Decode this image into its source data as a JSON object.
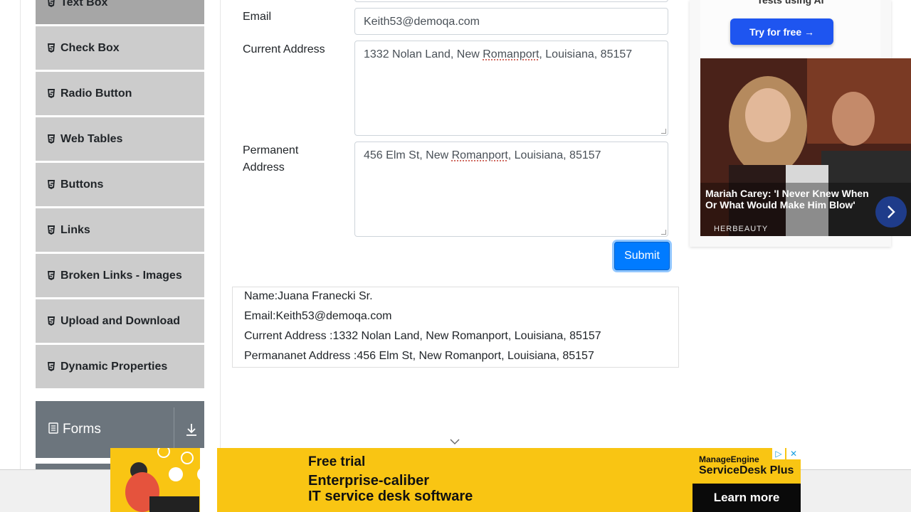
{
  "sidebar": {
    "items": [
      {
        "label": "Text Box"
      },
      {
        "label": "Check Box"
      },
      {
        "label": "Radio Button"
      },
      {
        "label": "Web Tables"
      },
      {
        "label": "Buttons"
      },
      {
        "label": "Links"
      },
      {
        "label": "Broken Links - Images"
      },
      {
        "label": "Upload and Download"
      },
      {
        "label": "Dynamic Properties"
      }
    ],
    "next_group": {
      "label": "Forms"
    }
  },
  "form": {
    "email": {
      "label": "Email",
      "value": "Keith53@demoqa.com"
    },
    "current_address": {
      "label": "Current Address",
      "value_before": "1332 Nolan Land, New ",
      "value_flagged": "Romanport",
      "value_after": ", Louisiana, 85157"
    },
    "permanent_address": {
      "label_line1": "Permanent",
      "label_line2": "Address",
      "value_before": "456 Elm St, New ",
      "value_flagged": "Romanport",
      "value_after": ", Louisiana, 85157"
    },
    "submit_label": "Submit"
  },
  "output": {
    "name": "Name:Juana Franecki Sr.",
    "email": "Email:Keith53@demoqa.com",
    "current_address": "Current Address :1332 Nolan Land, New Romanport, Louisiana, 85157",
    "permanent_address": "Permananet Address :456 Elm St, New Romanport, Louisiana, 85157"
  },
  "ad_right": {
    "top_text": "Tests using AI",
    "button_label": "Try for free →",
    "caption": "Mariah Carey: 'I Never Knew When Or What Would Make Him Blow'",
    "source": "HERBEAUTY"
  },
  "ad_bottom": {
    "line1": "Free trial",
    "line2": "Enterprise-caliber",
    "line3": "IT service desk software",
    "brand_line1": "ManageEngine",
    "brand_line2": "ServiceDesk Plus",
    "cta": "Learn more",
    "choices_icon": "ad-choices-icon",
    "close_icon": "close-icon"
  },
  "colors": {
    "accent": "#007bff",
    "sidebar_item_bg": "#cccccc",
    "sidebar_group_bg": "#6c757d",
    "banner_bg": "#f9c513"
  }
}
